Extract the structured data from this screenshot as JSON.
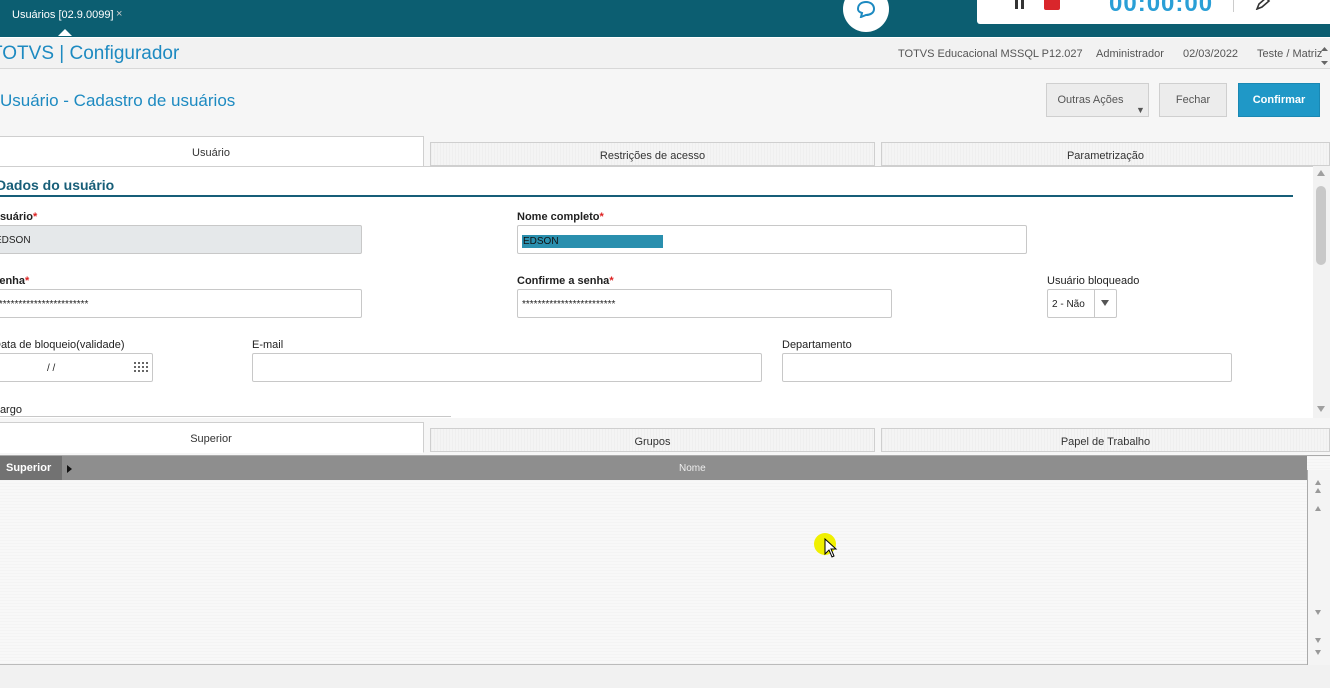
{
  "topbar": {
    "tab_label": "Usuários [02.9.0099]",
    "tab_close": "×",
    "timer": "00:00:00"
  },
  "header": {
    "app_title": "TOTVS | Configurador",
    "environment": "TOTVS Educacional MSSQL P12.027",
    "user": "Administrador",
    "date": "02/03/2022",
    "branch": "Teste / Matriz"
  },
  "page": {
    "title": "Usuário - Cadastro de usuários"
  },
  "actions": {
    "outras": "Outras Ações",
    "fechar": "Fechar",
    "confirmar": "Confirmar"
  },
  "tabs": [
    "Usuário",
    "Restrições de acesso",
    "Parametrização"
  ],
  "form": {
    "section_title": "Dados do usuário",
    "usuario_label": "Usuário",
    "usuario_value": "EDSON",
    "nome_label": "Nome completo",
    "nome_value": "EDSON",
    "senha_label": "Senha",
    "senha_value": "************************",
    "confirme_label": "Confirme a senha",
    "confirme_value": "************************",
    "bloqueado_label": "Usuário bloqueado",
    "bloqueado_value": "2 - Não",
    "data_label": "Data de bloqueio(validade)",
    "data_value": "/  /",
    "email_label": "E-mail",
    "email_value": "",
    "depto_label": "Departamento",
    "depto_value": "",
    "cargo_label": "Cargo",
    "required_mark": "*"
  },
  "subtabs": [
    "Superior",
    "Grupos",
    "Papel de Trabalho"
  ],
  "grid": {
    "columns": [
      "Superior",
      "Nome"
    ],
    "rows": []
  },
  "colors": {
    "accent": "#1d8ac1",
    "confirm": "#1f98c7",
    "section": "#175e78",
    "topbar": "#0c5e71"
  }
}
